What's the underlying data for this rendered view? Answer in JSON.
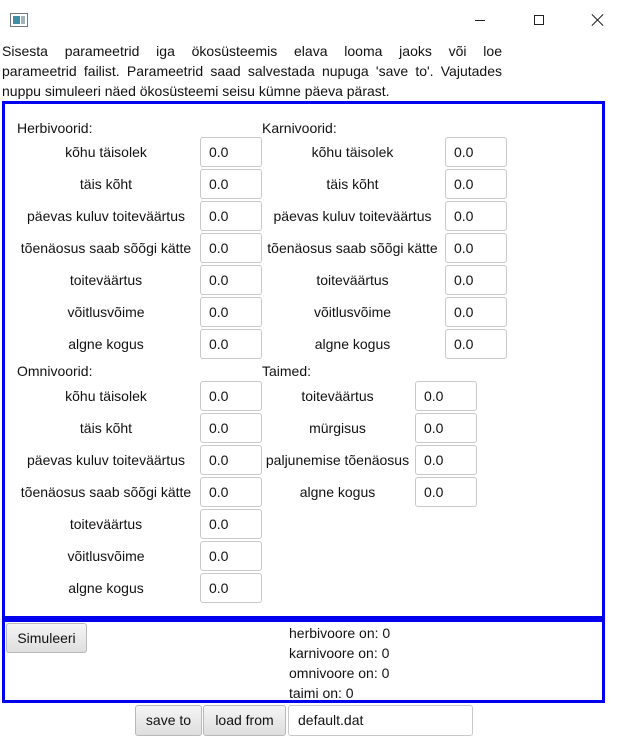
{
  "window": {
    "icon": "java-app-icon",
    "controls": [
      "minimize-icon",
      "maximize-icon",
      "close-icon"
    ]
  },
  "intro": [
    "Sisesta parameetrid iga ökosüsteemis elava looma jaoks või loe",
    "parameetrid failist. Parameetrid saad salvestada nupuga 'save to'. Vajutades",
    "nuppu simuleeri näed ökosüsteemi seisu kümne päeva pärast."
  ],
  "herbivoorid": {
    "title": "Herbivoorid:",
    "rows": [
      {
        "label": "kõhu täisolek",
        "value": "0.0"
      },
      {
        "label": "täis kõht",
        "value": "0.0"
      },
      {
        "label": "päevas kuluv toiteväärtus",
        "value": "0.0"
      },
      {
        "label": "tõenäosus saab sõõgi kätte",
        "value": "0.0"
      },
      {
        "label": "toiteväärtus",
        "value": "0.0"
      },
      {
        "label": "võitlusvõime",
        "value": "0.0"
      },
      {
        "label": "algne kogus",
        "value": "0.0"
      }
    ]
  },
  "karnivoorid": {
    "title": "Karnivoorid:",
    "rows": [
      {
        "label": "kõhu täisolek",
        "value": "0.0"
      },
      {
        "label": "täis kõht",
        "value": "0.0"
      },
      {
        "label": "päevas kuluv toiteväärtus",
        "value": "0.0"
      },
      {
        "label": "tõenäosus saab sõõgi kätte",
        "value": "0.0"
      },
      {
        "label": "toiteväärtus",
        "value": "0.0"
      },
      {
        "label": "võitlusvõime",
        "value": "0.0"
      },
      {
        "label": "algne kogus",
        "value": "0.0"
      }
    ]
  },
  "omnivoorid": {
    "title": "Omnivoorid:",
    "rows": [
      {
        "label": "kõhu täisolek",
        "value": "0.0"
      },
      {
        "label": "täis kõht",
        "value": "0.0"
      },
      {
        "label": "päevas kuluv toiteväärtus",
        "value": "0.0"
      },
      {
        "label": "tõenäosus saab sõõgi kätte",
        "value": "0.0"
      },
      {
        "label": "toiteväärtus",
        "value": "0.0"
      },
      {
        "label": "võitlusvõime",
        "value": "0.0"
      },
      {
        "label": "algne kogus",
        "value": "0.0"
      }
    ]
  },
  "taimed": {
    "title": "Taimed:",
    "rows": [
      {
        "label": "toiteväärtus",
        "value": "0.0"
      },
      {
        "label": "mürgisus",
        "value": "0.0"
      },
      {
        "label": "paljunemise tõenäosus",
        "value": "0.0"
      },
      {
        "label": "algne kogus",
        "value": "0.0"
      }
    ]
  },
  "simulation": {
    "button_label": "Simuleeri",
    "stats": [
      "herbivoore on: 0",
      "karnivoore on: 0",
      "omnivoore on: 0",
      "taimi on: 0"
    ]
  },
  "file": {
    "save_label": "save to",
    "load_label": "load from",
    "filename": "default.dat"
  },
  "colors": {
    "panel_border": "#0000ee"
  }
}
